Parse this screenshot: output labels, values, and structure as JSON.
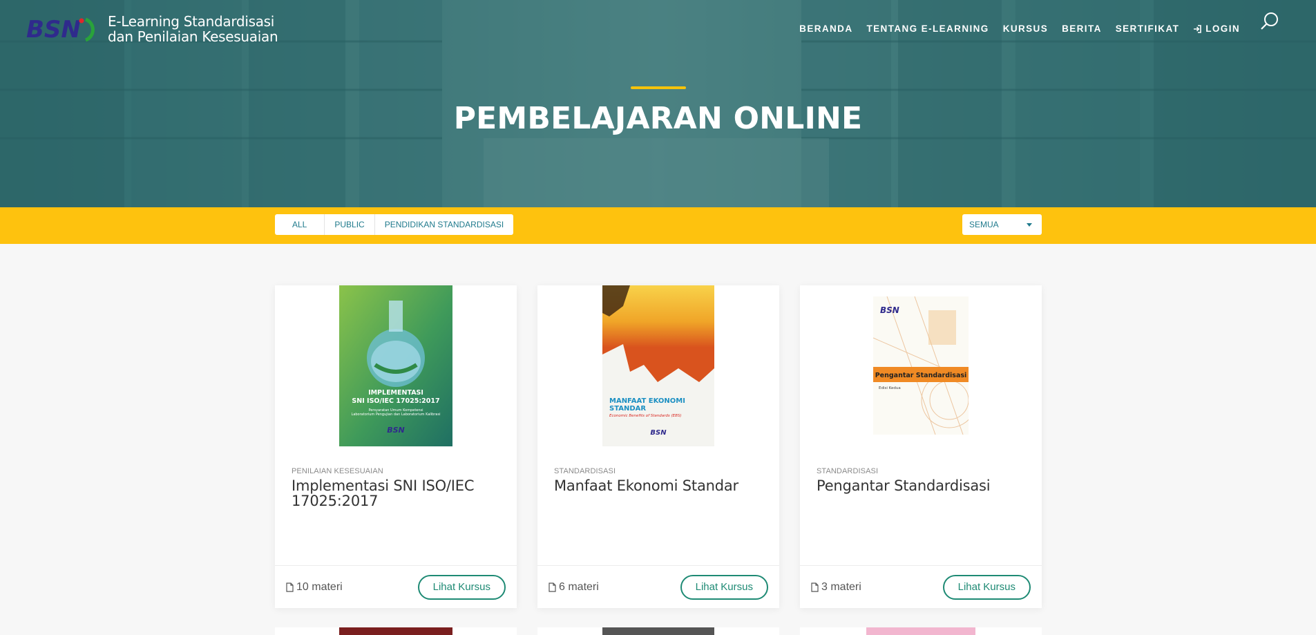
{
  "header": {
    "logo_text": "BSN",
    "site_title_line1": "E-Learning Standardisasi",
    "site_title_line2": "dan Penilaian Kesesuaian",
    "nav": [
      {
        "label": "BERANDA"
      },
      {
        "label": "TENTANG E-LEARNING"
      },
      {
        "label": "KURSUS"
      },
      {
        "label": "BERITA"
      },
      {
        "label": "SERTIFIKAT"
      },
      {
        "label": "LOGIN",
        "icon": "sign-in-icon"
      }
    ],
    "search_icon": "search-icon"
  },
  "hero": {
    "title": "PEMBELAJARAN ONLINE"
  },
  "filters": {
    "tabs": [
      {
        "label": "ALL"
      },
      {
        "label": "PUBLIC"
      },
      {
        "label": "PENDIDIKAN STANDARDISASI"
      }
    ],
    "select_value": "SEMUA"
  },
  "courses": [
    {
      "category": "PENILAIAN KESESUAIAN",
      "title": "Implementasi SNI ISO/IEC 17025:2017",
      "materi": "10 materi",
      "button": "Lihat Kursus",
      "cover": {
        "title": "IMPLEMENTASI\nSNI ISO/IEC 17025:2017",
        "subtitle": "Persyaratan Umum Kompetensi\nLaboratorium Pengujian dan Laboratorium Kalibrasi",
        "brand": "BSN",
        "colors": [
          "#6fae43",
          "#2e7d6b"
        ]
      }
    },
    {
      "category": "STANDARDISASI",
      "title": "Manfaat Ekonomi Standar",
      "materi": "6 materi",
      "button": "Lihat Kursus",
      "cover": {
        "title": "MANFAAT EKONOMI\nSTANDAR",
        "subtitle": "Economic Benefits of Standards (EBS)",
        "brand": "BSN",
        "colors": [
          "#f2b21b",
          "#d9531e"
        ]
      }
    },
    {
      "category": "STANDARDISASI",
      "title": "Pengantar Standardisasi",
      "materi": "3 materi",
      "button": "Lihat Kursus",
      "cover": {
        "title": "Pengantar Standardisasi",
        "subtitle": "Edisi Kedua",
        "brand": "BSN",
        "colors": [
          "#f28c28",
          "#ffffff"
        ]
      }
    }
  ],
  "colors": {
    "hero_teal": "#3d7c80",
    "accent_yellow": "#fec20e",
    "link_teal": "#1f7a8c",
    "button_green": "#1e8a74"
  }
}
